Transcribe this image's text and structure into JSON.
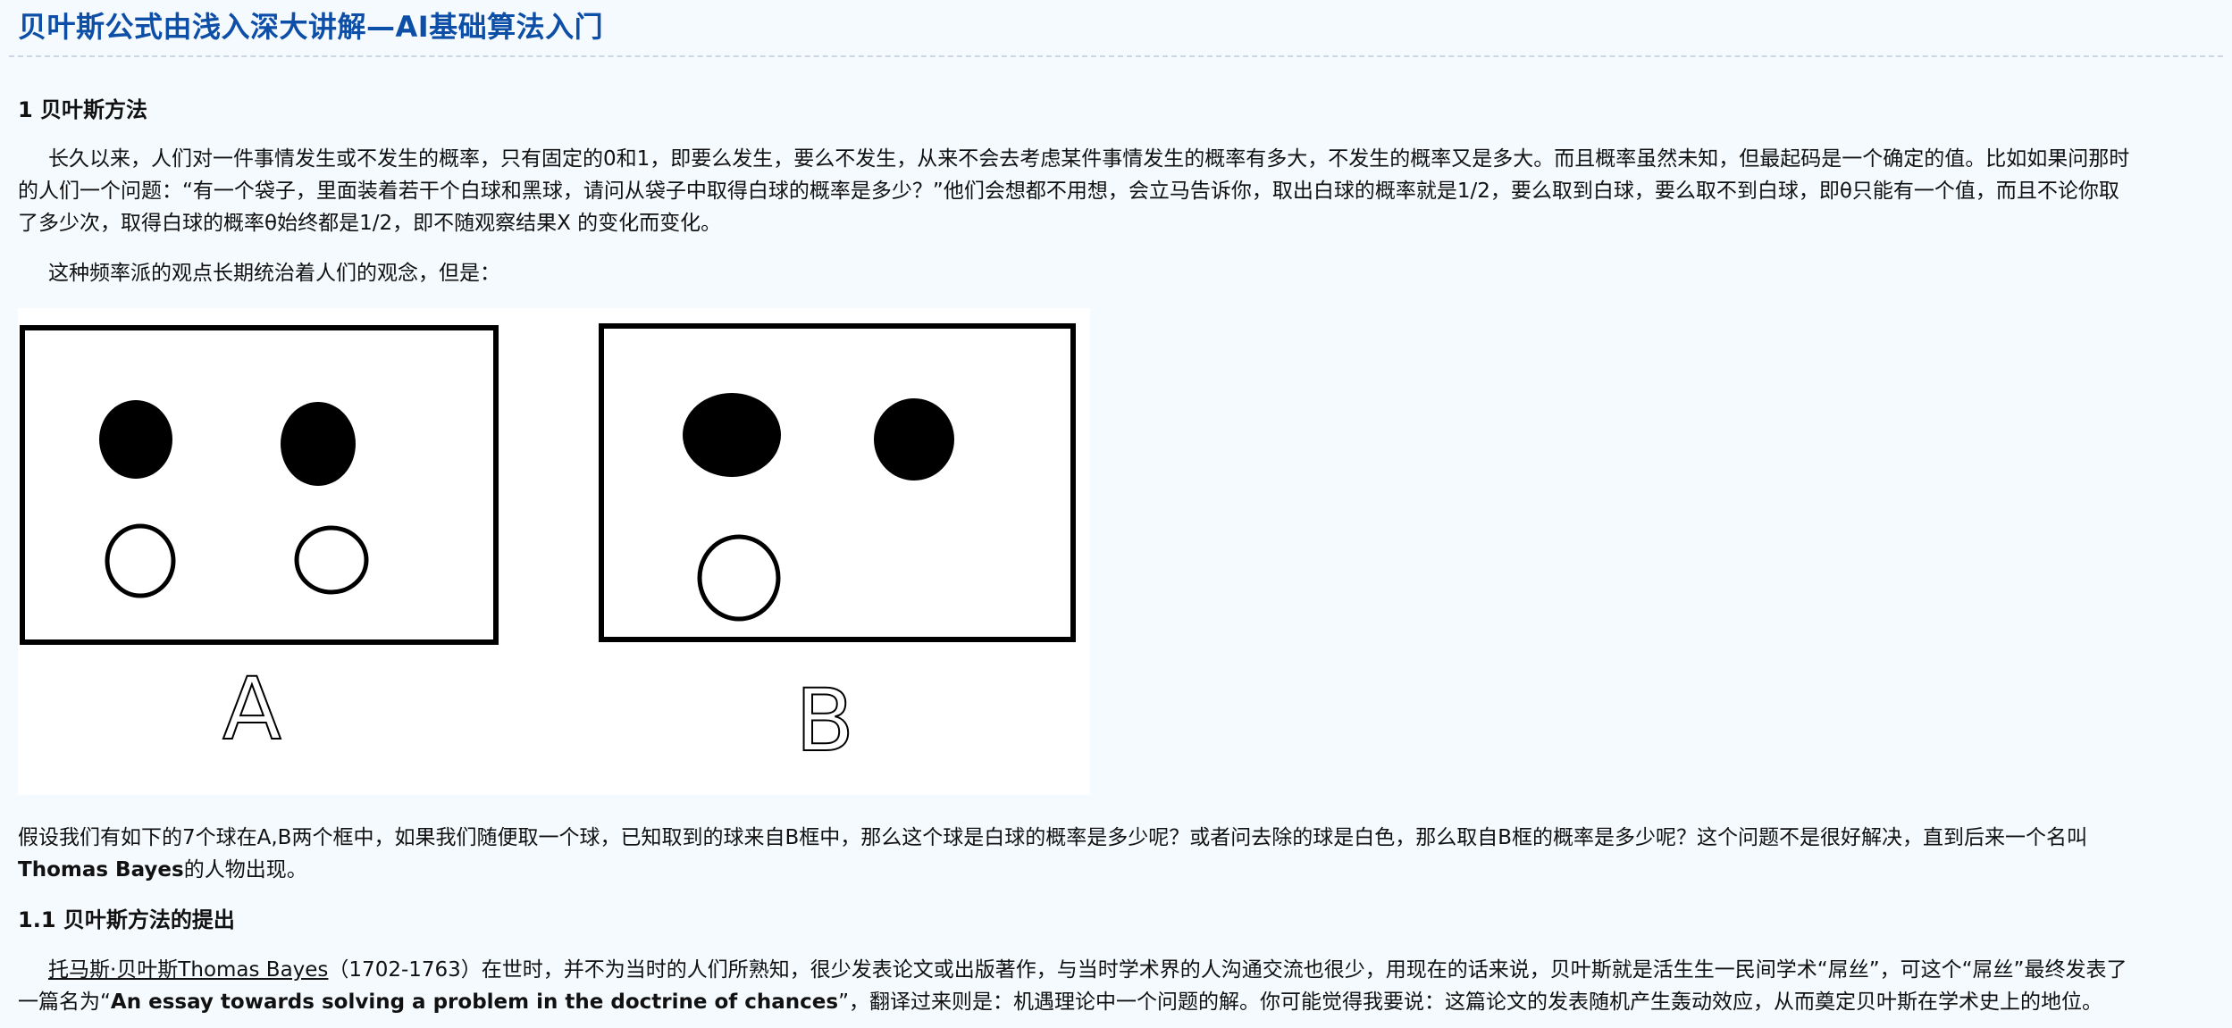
{
  "article": {
    "title": "贝叶斯公式由浅入深大讲解—AI基础算法入门",
    "section1": {
      "heading": "1 贝叶斯方法",
      "p1": {
        "line1": "长久以来，人们对一件事情发生或不发生的概率，只有固定的0和1，即要么发生，要么不发生，从来不会去考虑某件事情发生的概率有多大，不发生的概率又是多大。而且概率虽然未知，但最起码是一个确定的值。比如如果问那时",
        "line2": "的人们一个问题：“有一个袋子，里面装着若干个白球和黑球，请问从袋子中取得白球的概率是多少？”他们会想都不用想，会立马告诉你，取出白球的概率就是1/2，要么取到白球，要么取不到白球，即θ只能有一个值，而且不论你取",
        "line3": "了多少次，取得白球的概率θ始终都是1/2，即不随观察结果X 的变化而变化。"
      },
      "p2": "这种频率派的观点长期统治着人们的观念，但是：",
      "figure": {
        "label_a": "A",
        "label_b": "B"
      },
      "p3": {
        "line1": "假设我们有如下的7个球在A,B两个框中，如果我们随便取一个球，已知取到的球来自B框中，那么这个球是白球的概率是多少呢？或者问去除的球是白色，那么取自B框的概率是多少呢？这个问题不是很好解决，直到后来一个名叫",
        "line2_bold": "Thomas Bayes",
        "line2_rest": "的人物出现。"
      }
    },
    "section1_1": {
      "heading": "1.1 贝叶斯方法的提出",
      "p1": {
        "link": "托马斯·贝叶斯Thomas Bayes",
        "line1_rest": "（1702-1763）在世时，并不为当时的人们所熟知，很少发表论文或出版著作，与当时学术界的人沟通交流也很少，用现在的话来说，贝叶斯就是活生生一民间学术“屌丝”，可这个“屌丝”最终发表了",
        "line2_pre": "一篇名为“",
        "line2_bold": "An essay towards solving a problem in the doctrine of chances",
        "line2_rest": "”，翻译过来则是：机遇理论中一个问题的解。你可能觉得我要说：这篇论文的发表随机产生轰动效应，从而奠定贝叶斯在学术史上的地位。"
      }
    }
  }
}
